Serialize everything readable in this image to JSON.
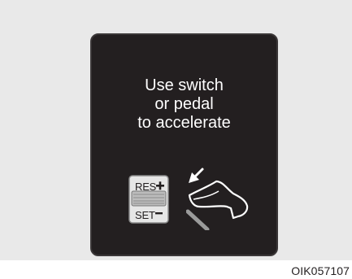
{
  "display": {
    "message_lines": [
      "Use switch",
      "or pedal",
      "to accelerate"
    ]
  },
  "switch": {
    "res_label": "RES",
    "set_label": "SET",
    "plus_symbol": "+",
    "minus_symbol": "−"
  },
  "icons": {
    "switch": "cruise-control-switch-icon",
    "pedal": "accelerator-pedal-icon"
  },
  "figure": {
    "code": "OIK057107"
  },
  "colors": {
    "background": "#e9e9e9",
    "screen": "#231f20",
    "text": "#ffffff"
  }
}
